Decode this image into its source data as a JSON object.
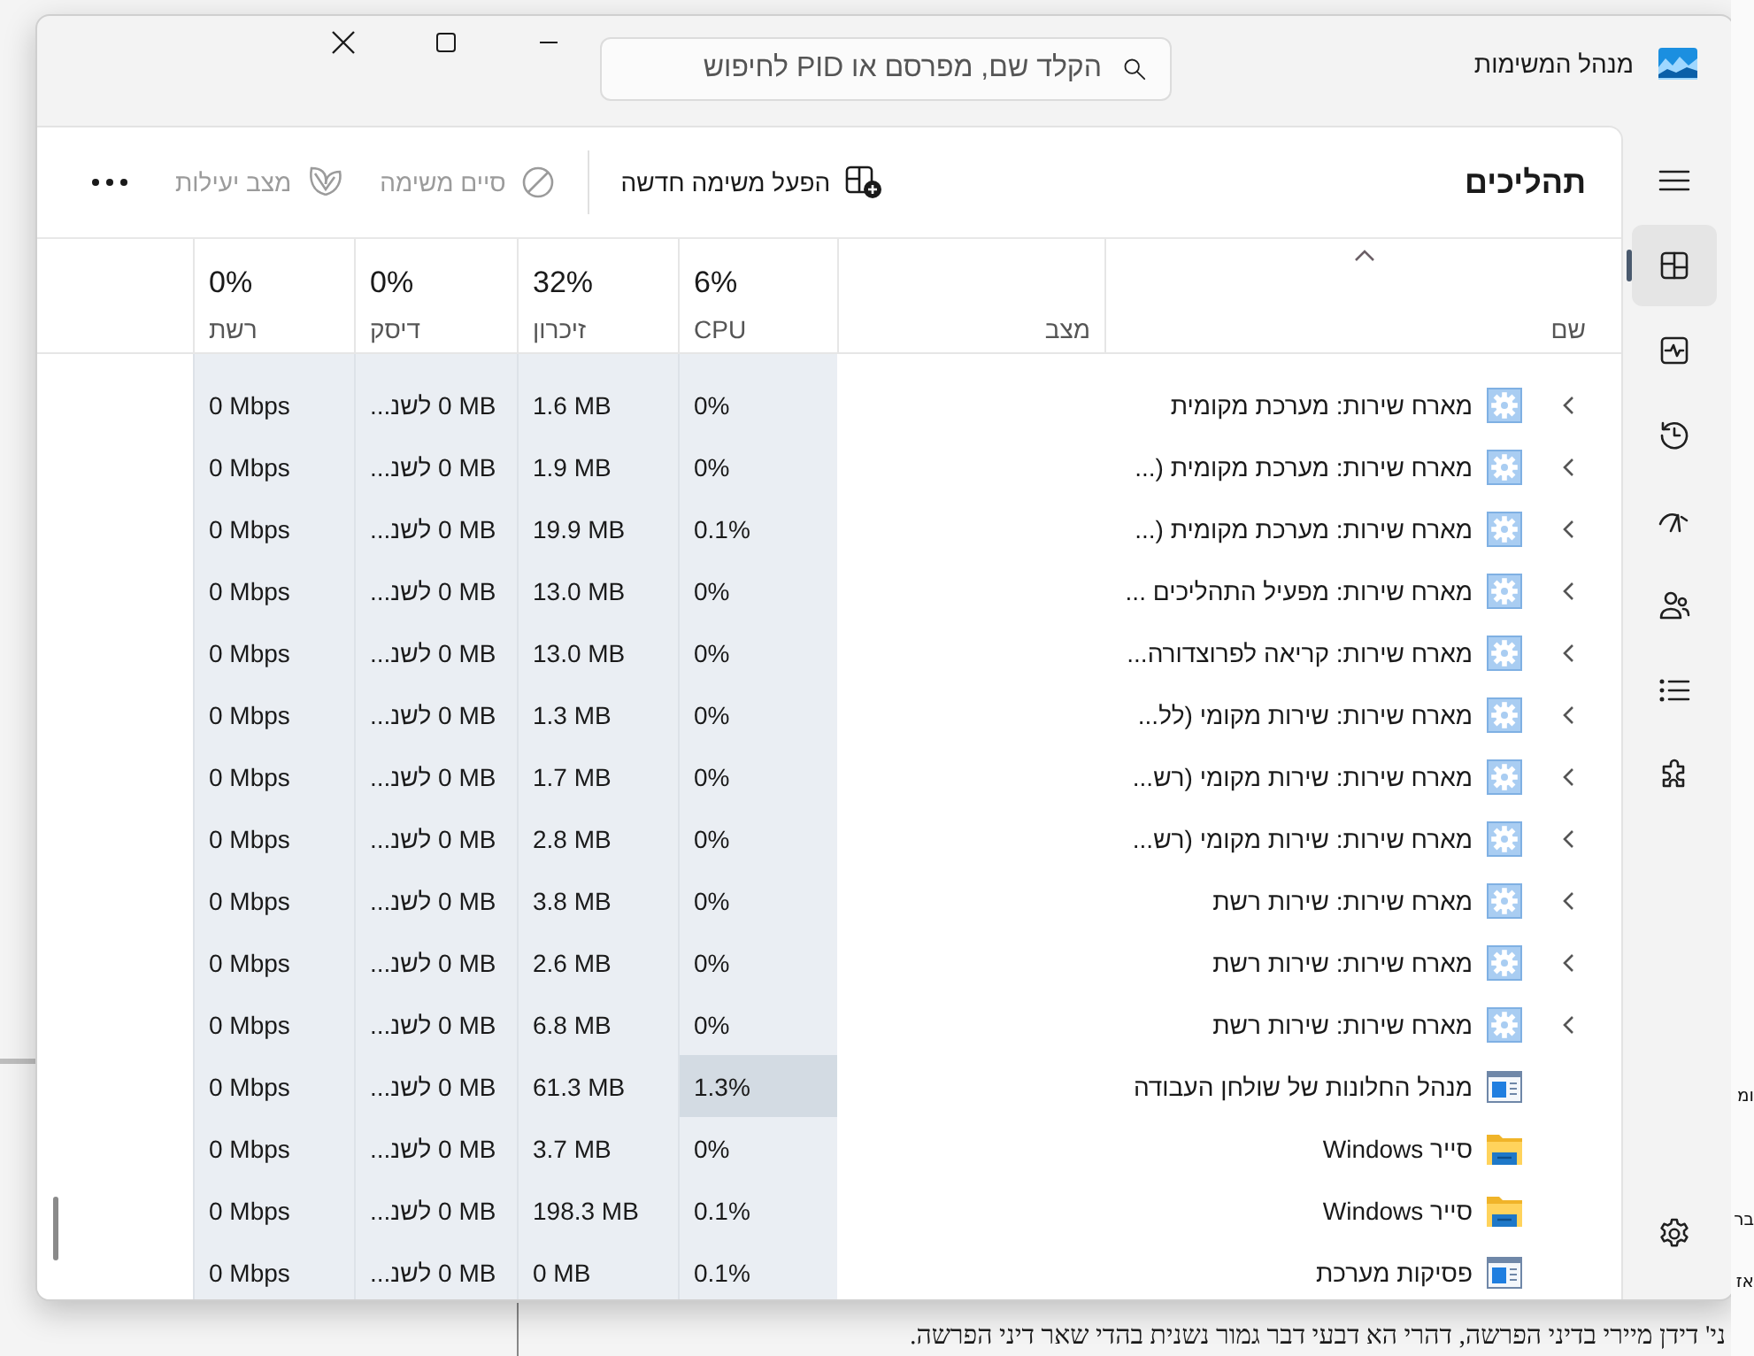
{
  "window": {
    "title": "מנהל המשימות"
  },
  "search": {
    "placeholder": "הקלד שם, מפרסם או PID לחיפוש"
  },
  "nav": [
    {
      "kind": "menu",
      "selected": false
    },
    {
      "kind": "processes",
      "selected": true
    },
    {
      "kind": "performance",
      "selected": false
    },
    {
      "kind": "history",
      "selected": false
    },
    {
      "kind": "startup",
      "selected": false
    },
    {
      "kind": "users",
      "selected": false
    },
    {
      "kind": "details",
      "selected": false
    },
    {
      "kind": "services",
      "selected": false
    }
  ],
  "page_title": "תהליכים",
  "toolbar": [
    {
      "kind": "new",
      "label": "הפעל משימה חדשה",
      "disabled": false
    },
    {
      "kind": "end",
      "label": "סיים משימה",
      "disabled": true
    },
    {
      "kind": "efficiency",
      "label": "מצב יעילות",
      "disabled": true
    }
  ],
  "columns": [
    {
      "label": "שם",
      "sorted": true
    },
    {
      "label": "מצב",
      "sorted": false
    },
    {
      "label": "CPU",
      "percent": "6%",
      "sorted": false
    },
    {
      "label": "זיכרון",
      "percent": "32%",
      "sorted": false
    },
    {
      "label": "דיסק",
      "percent": "0%",
      "sorted": false
    },
    {
      "label": "רשת",
      "percent": "0%",
      "sorted": false
    }
  ],
  "rows": [
    {
      "name": "מארח שירות: מערכת מקומית",
      "kind": "service",
      "expandable": true,
      "cpu": "0%",
      "cpu_highlight": false,
      "memory": "1.6 MB",
      "disk": "‎0 MB לשנ...",
      "network": "0 Mbps"
    },
    {
      "name": "מארח שירות: מערכת מקומית (...",
      "kind": "service",
      "expandable": true,
      "cpu": "0%",
      "cpu_highlight": false,
      "memory": "1.9 MB",
      "disk": "‎0 MB לשנ...",
      "network": "0 Mbps"
    },
    {
      "name": "מארח שירות: מערכת מקומית (...",
      "kind": "service",
      "expandable": true,
      "cpu": "0.1%",
      "cpu_highlight": false,
      "memory": "19.9 MB",
      "disk": "‎0 MB לשנ...",
      "network": "0 Mbps"
    },
    {
      "name": "מארח שירות: מפעיל התהליכים ...",
      "kind": "service",
      "expandable": true,
      "cpu": "0%",
      "cpu_highlight": false,
      "memory": "13.0 MB",
      "disk": "‎0 MB לשנ...",
      "network": "0 Mbps"
    },
    {
      "name": "מארח שירות: קריאה לפרוצדורה...",
      "kind": "service",
      "expandable": true,
      "cpu": "0%",
      "cpu_highlight": false,
      "memory": "13.0 MB",
      "disk": "‎0 MB לשנ...",
      "network": "0 Mbps"
    },
    {
      "name": "מארח שירות: שירות מקומי (לל...",
      "kind": "service",
      "expandable": true,
      "cpu": "0%",
      "cpu_highlight": false,
      "memory": "1.3 MB",
      "disk": "‎0 MB לשנ...",
      "network": "0 Mbps"
    },
    {
      "name": "מארח שירות: שירות מקומי (רש...",
      "kind": "service",
      "expandable": true,
      "cpu": "0%",
      "cpu_highlight": false,
      "memory": "1.7 MB",
      "disk": "‎0 MB לשנ...",
      "network": "0 Mbps"
    },
    {
      "name": "מארח שירות: שירות מקומי (רש...",
      "kind": "service",
      "expandable": true,
      "cpu": "0%",
      "cpu_highlight": false,
      "memory": "2.8 MB",
      "disk": "‎0 MB לשנ...",
      "network": "0 Mbps"
    },
    {
      "name": "מארח שירות: שירות רשת",
      "kind": "service",
      "expandable": true,
      "cpu": "0%",
      "cpu_highlight": false,
      "memory": "3.8 MB",
      "disk": "‎0 MB לשנ...",
      "network": "0 Mbps"
    },
    {
      "name": "מארח שירות: שירות רשת",
      "kind": "service",
      "expandable": true,
      "cpu": "0%",
      "cpu_highlight": false,
      "memory": "2.6 MB",
      "disk": "‎0 MB לשנ...",
      "network": "0 Mbps"
    },
    {
      "name": "מארח שירות: שירות רשת",
      "kind": "service",
      "expandable": true,
      "cpu": "0%",
      "cpu_highlight": false,
      "memory": "6.8 MB",
      "disk": "‎0 MB לשנ...",
      "network": "0 Mbps"
    },
    {
      "name": "מנהל החלונות של שולחן העבודה",
      "kind": "window",
      "expandable": false,
      "cpu": "1.3%",
      "cpu_highlight": true,
      "memory": "61.3 MB",
      "disk": "‎0 MB לשנ...",
      "network": "0 Mbps"
    },
    {
      "name": "סייר Windows",
      "kind": "folder",
      "expandable": false,
      "cpu": "0%",
      "cpu_highlight": false,
      "memory": "3.7 MB",
      "disk": "‎0 MB לשנ...",
      "network": "0 Mbps"
    },
    {
      "name": "סייר Windows",
      "kind": "folder",
      "expandable": false,
      "cpu": "0.1%",
      "cpu_highlight": false,
      "memory": "198.3 MB",
      "disk": "‎0 MB לשנ...",
      "network": "0 Mbps"
    },
    {
      "name": "פסיקות מערכת",
      "kind": "window",
      "expandable": false,
      "cpu": "0.1%",
      "cpu_highlight": false,
      "memory": "0 MB",
      "disk": "‎0 MB לשנ...",
      "network": "0 Mbps"
    }
  ],
  "background_document": {
    "side_fragments": [
      "ומ",
      "בר",
      "אז"
    ],
    "bottom_line": "ני' דידן מיירי בדיני הפרשה, דהרי הא דבעי דבר גמור נשנית בהדי שאר דיני הפרשה."
  }
}
